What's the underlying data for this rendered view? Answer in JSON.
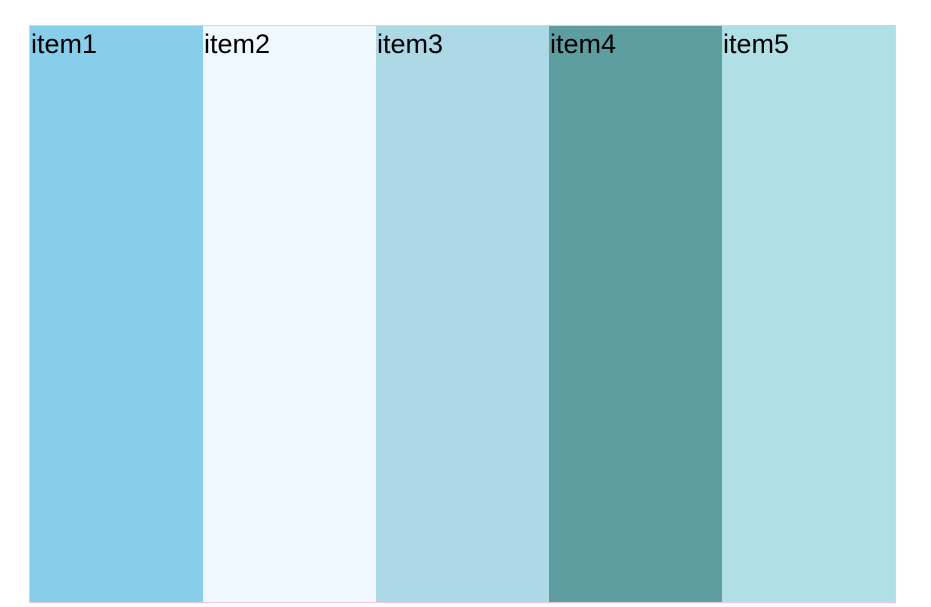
{
  "container": {
    "border_color": "#f2c6dc",
    "items": [
      {
        "label": "item1",
        "color": "#87ceeb"
      },
      {
        "label": "item2",
        "color": "#f0f8ff"
      },
      {
        "label": "item3",
        "color": "#add8e6"
      },
      {
        "label": "item4",
        "color": "#5f9ea0"
      },
      {
        "label": "item5",
        "color": "#b0e0e6"
      }
    ]
  }
}
